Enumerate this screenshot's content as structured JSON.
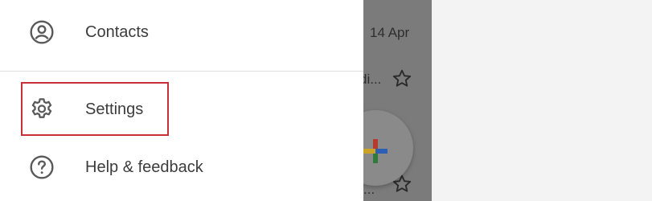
{
  "drawer": {
    "items": [
      {
        "label": "Contacts",
        "icon": "account-circle-icon"
      },
      {
        "label": "Settings",
        "icon": "gear-icon"
      },
      {
        "label": "Help & feedback",
        "icon": "help-circle-icon"
      }
    ],
    "highlighted_item": "Settings",
    "highlight_color": "#c8303a"
  },
  "background": {
    "date": "14 Apr",
    "snippet_1": "di...",
    "snippet_2": "...",
    "fab_icon": "plus-compose-icon"
  },
  "colors": {
    "scrim": "#7b7b7b",
    "drawer_bg": "#ffffff",
    "text": "#3c3c3c"
  }
}
